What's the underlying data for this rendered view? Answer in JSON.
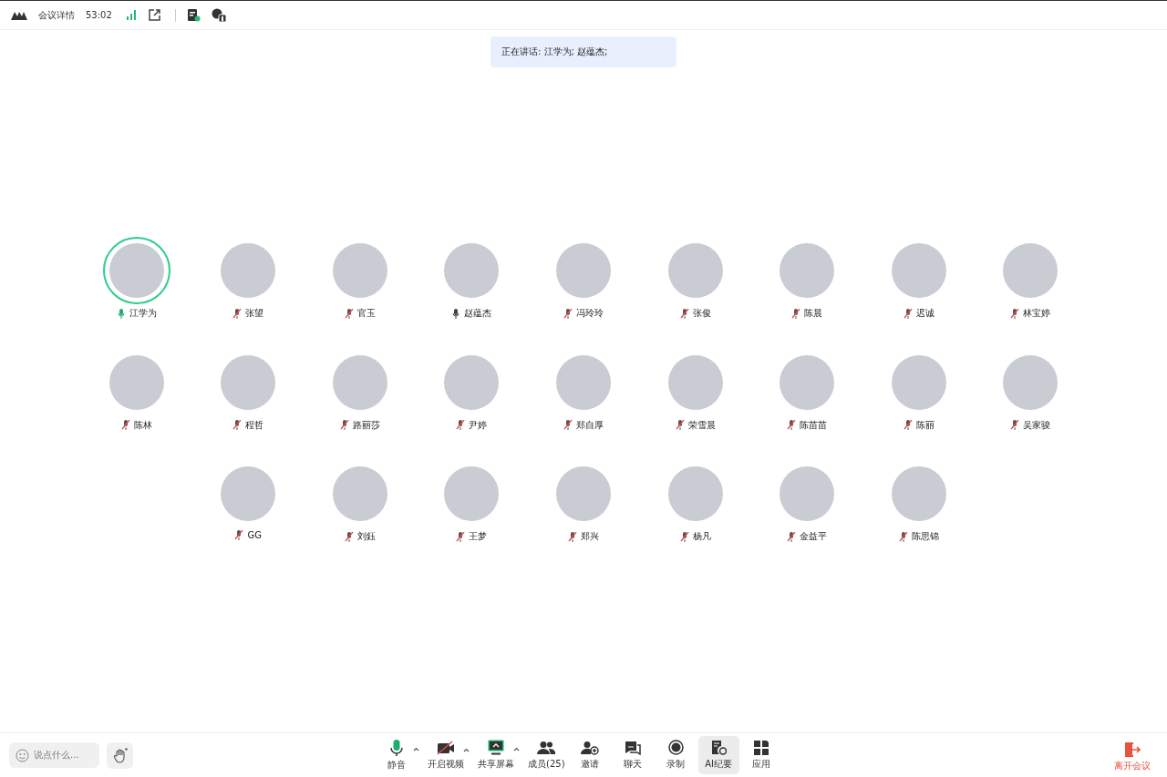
{
  "top_bar": {
    "title": "会议详情",
    "duration": "53:02"
  },
  "speaking_banner": "正在讲话: 江学为; 赵蕴杰;",
  "participants": [
    {
      "name": "江学为",
      "kind": "speaking",
      "highlighted": true
    },
    {
      "name": "张望",
      "kind": "muted",
      "highlighted": false
    },
    {
      "name": "官玉",
      "kind": "muted",
      "highlighted": false
    },
    {
      "name": "赵蕴杰",
      "kind": "unmuted",
      "highlighted": false
    },
    {
      "name": "冯玲玲",
      "kind": "muted",
      "highlighted": false
    },
    {
      "name": "张俊",
      "kind": "muted",
      "highlighted": false
    },
    {
      "name": "陈晨",
      "kind": "muted",
      "highlighted": false
    },
    {
      "name": "迟诚",
      "kind": "muted",
      "highlighted": false
    },
    {
      "name": "林宝婷",
      "kind": "muted",
      "highlighted": false
    },
    {
      "name": "陈林",
      "kind": "muted",
      "highlighted": false
    },
    {
      "name": "程哲",
      "kind": "muted",
      "highlighted": false
    },
    {
      "name": "路丽莎",
      "kind": "muted",
      "highlighted": false
    },
    {
      "name": "尹婷",
      "kind": "muted",
      "highlighted": false
    },
    {
      "name": "郑自厚",
      "kind": "muted",
      "highlighted": false
    },
    {
      "name": "荣雪晨",
      "kind": "muted",
      "highlighted": false
    },
    {
      "name": "陈苗苗",
      "kind": "muted",
      "highlighted": false
    },
    {
      "name": "陈丽",
      "kind": "muted",
      "highlighted": false
    },
    {
      "name": "吴家骏",
      "kind": "muted",
      "highlighted": false
    },
    {
      "name": "GG",
      "kind": "muted",
      "highlighted": false
    },
    {
      "name": "刘鈺",
      "kind": "muted",
      "highlighted": false
    },
    {
      "name": "王梦",
      "kind": "muted",
      "highlighted": false
    },
    {
      "name": "郑兴",
      "kind": "muted",
      "highlighted": false
    },
    {
      "name": "杨凡",
      "kind": "muted",
      "highlighted": false
    },
    {
      "name": "金益平",
      "kind": "muted",
      "highlighted": false
    },
    {
      "name": "陈思锦",
      "kind": "muted",
      "highlighted": false
    }
  ],
  "chat_input": {
    "placeholder": "说点什么..."
  },
  "toolbar": [
    {
      "kind": "mic",
      "label": "静音",
      "caret": true,
      "selected": false
    },
    {
      "kind": "video",
      "label": "开启视频",
      "caret": true,
      "selected": false
    },
    {
      "kind": "share",
      "label": "共享屏幕",
      "caret": true,
      "selected": false
    },
    {
      "kind": "members",
      "label": "成员(25)",
      "caret": false,
      "selected": false
    },
    {
      "kind": "invite",
      "label": "邀请",
      "caret": false,
      "selected": false
    },
    {
      "kind": "chat",
      "label": "聊天",
      "caret": false,
      "selected": false
    },
    {
      "kind": "record",
      "label": "录制",
      "caret": false,
      "selected": false
    },
    {
      "kind": "ai",
      "label": "AI纪要",
      "caret": false,
      "selected": true
    },
    {
      "kind": "apps",
      "label": "应用",
      "caret": false,
      "selected": false
    }
  ],
  "leave_button": "离开会议"
}
